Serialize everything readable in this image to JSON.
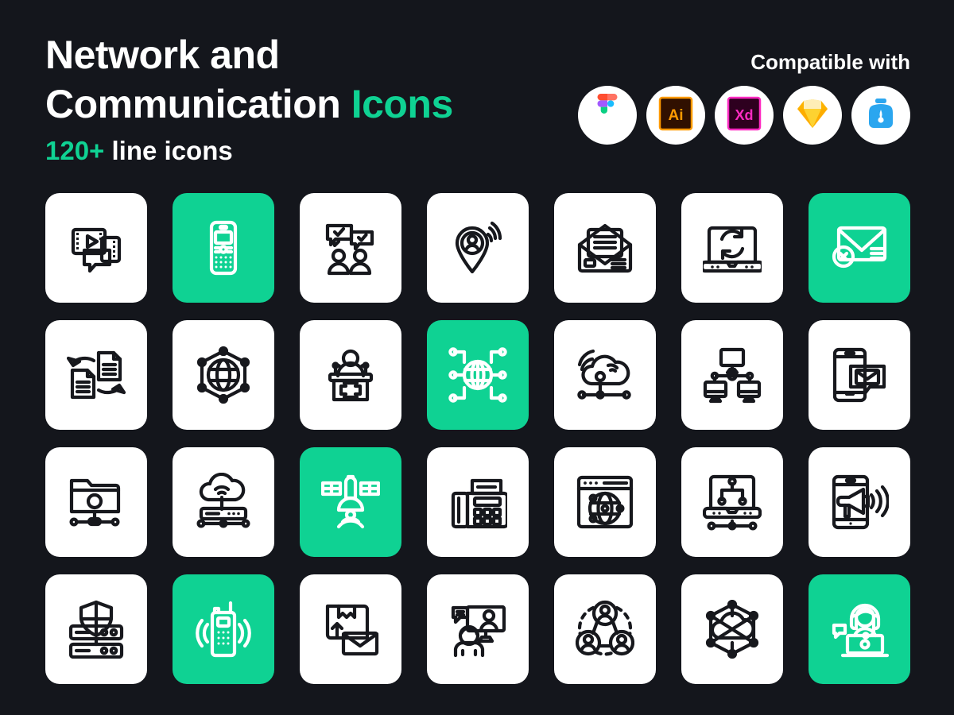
{
  "theme": {
    "background": "#14161C",
    "accent_green": "#0FD293",
    "tile_white": "#FFFFFF",
    "stroke_dark": "#17181D"
  },
  "header": {
    "title_line1": "Network and",
    "title_line2_plain": "Communication ",
    "title_line2_accent": "Icons",
    "subtitle_accent": "120+",
    "subtitle_plain": " line icons",
    "compatible_label": "Compatible with",
    "badges": [
      {
        "name": "figma-logo",
        "label": "Figma"
      },
      {
        "name": "adobe-illustrator-logo",
        "label": "Ai"
      },
      {
        "name": "adobe-xd-logo",
        "label": "Xd"
      },
      {
        "name": "sketch-logo",
        "label": "Sketch"
      },
      {
        "name": "lottie-logo",
        "label": "Lottie"
      }
    ]
  },
  "grid": {
    "columns": 7,
    "rows": 4,
    "tiles": [
      {
        "index": 1,
        "icon": "video-message-icon",
        "label": "Video message",
        "accent": false
      },
      {
        "index": 2,
        "icon": "feature-phone-icon",
        "label": "Feature phone",
        "accent": true
      },
      {
        "index": 3,
        "icon": "people-chat-approved-icon",
        "label": "People chat approved",
        "accent": false
      },
      {
        "index": 4,
        "icon": "location-signal-icon",
        "label": "Location broadcast",
        "accent": false
      },
      {
        "index": 5,
        "icon": "open-envelope-letter-icon",
        "label": "Open envelope letter",
        "accent": false
      },
      {
        "index": 6,
        "icon": "laptop-sync-icon",
        "label": "Laptop sync",
        "accent": false
      },
      {
        "index": 7,
        "icon": "email-rejected-icon",
        "label": "Email rejected",
        "accent": true
      },
      {
        "index": 8,
        "icon": "file-transfer-icon",
        "label": "File transfer",
        "accent": false
      },
      {
        "index": 9,
        "icon": "globe-hex-network-icon",
        "label": "Global network",
        "accent": false
      },
      {
        "index": 10,
        "icon": "press-conference-icon",
        "label": "Press conference",
        "accent": false
      },
      {
        "index": 11,
        "icon": "global-node-network-icon",
        "label": "Global node network",
        "accent": true
      },
      {
        "index": 12,
        "icon": "cloud-wifi-network-icon",
        "label": "Cloud wireless network",
        "accent": false
      },
      {
        "index": 13,
        "icon": "computer-lan-icon",
        "label": "Computer LAN",
        "accent": false
      },
      {
        "index": 14,
        "icon": "mobile-email-icon",
        "label": "Mobile email",
        "accent": false
      },
      {
        "index": 15,
        "icon": "shared-folder-icon",
        "label": "Shared folder",
        "accent": false
      },
      {
        "index": 16,
        "icon": "cloud-router-icon",
        "label": "Cloud router",
        "accent": false
      },
      {
        "index": 17,
        "icon": "satellite-icon",
        "label": "Satellite",
        "accent": true
      },
      {
        "index": 18,
        "icon": "fax-machine-icon",
        "label": "Fax machine",
        "accent": false
      },
      {
        "index": 19,
        "icon": "browser-globe-icon",
        "label": "Web browser globe",
        "accent": false
      },
      {
        "index": 20,
        "icon": "laptop-network-icon",
        "label": "Laptop network",
        "accent": false
      },
      {
        "index": 21,
        "icon": "mobile-megaphone-icon",
        "label": "Mobile announcement",
        "accent": false
      },
      {
        "index": 22,
        "icon": "secure-server-icon",
        "label": "Secure server",
        "accent": false
      },
      {
        "index": 23,
        "icon": "walkie-talkie-icon",
        "label": "Walkie talkie",
        "accent": true
      },
      {
        "index": 24,
        "icon": "package-mail-icon",
        "label": "Package mail",
        "accent": false
      },
      {
        "index": 25,
        "icon": "video-conference-icon",
        "label": "Video conference",
        "accent": false
      },
      {
        "index": 26,
        "icon": "social-network-icon",
        "label": "Social network",
        "accent": false
      },
      {
        "index": 27,
        "icon": "cloud-hex-network-icon",
        "label": "Cloud network",
        "accent": false
      },
      {
        "index": 28,
        "icon": "support-agent-icon",
        "label": "Customer support",
        "accent": true
      }
    ]
  }
}
